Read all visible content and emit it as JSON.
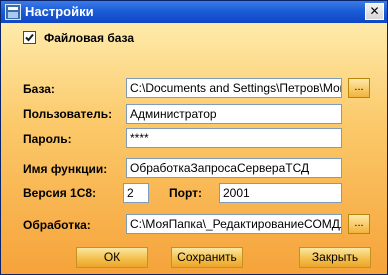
{
  "window": {
    "title": "Настройки",
    "close_glyph": "✕"
  },
  "file_db": {
    "label": "Файловая база",
    "checked": true
  },
  "fields": {
    "base": {
      "label": "База:",
      "value": "C:\\Documents and Settings\\Петров\\Мои д",
      "browse_label": "..."
    },
    "user": {
      "label": "Пользователь:",
      "value": "Администратор"
    },
    "password": {
      "label": "Пароль:",
      "value": "****"
    },
    "function": {
      "label": "Имя функции:",
      "value": "ОбработкаЗапросаСервераТСД"
    },
    "version": {
      "label": "Версия 1С8:",
      "value": "2"
    },
    "port": {
      "label": "Порт:",
      "value": "2001"
    },
    "processing": {
      "label": "Обработка:",
      "value": "C:\\МояПапка\\_РедактированиеСОМДля",
      "browse_label": "..."
    }
  },
  "buttons": {
    "ok": "ОК",
    "save": "Сохранить",
    "close": "Закрыть"
  },
  "colors": {
    "title_bar": "#1d5fd8",
    "background_top": "#fff2b8",
    "background_bottom": "#f6a33a",
    "button": "#f4c04e"
  }
}
